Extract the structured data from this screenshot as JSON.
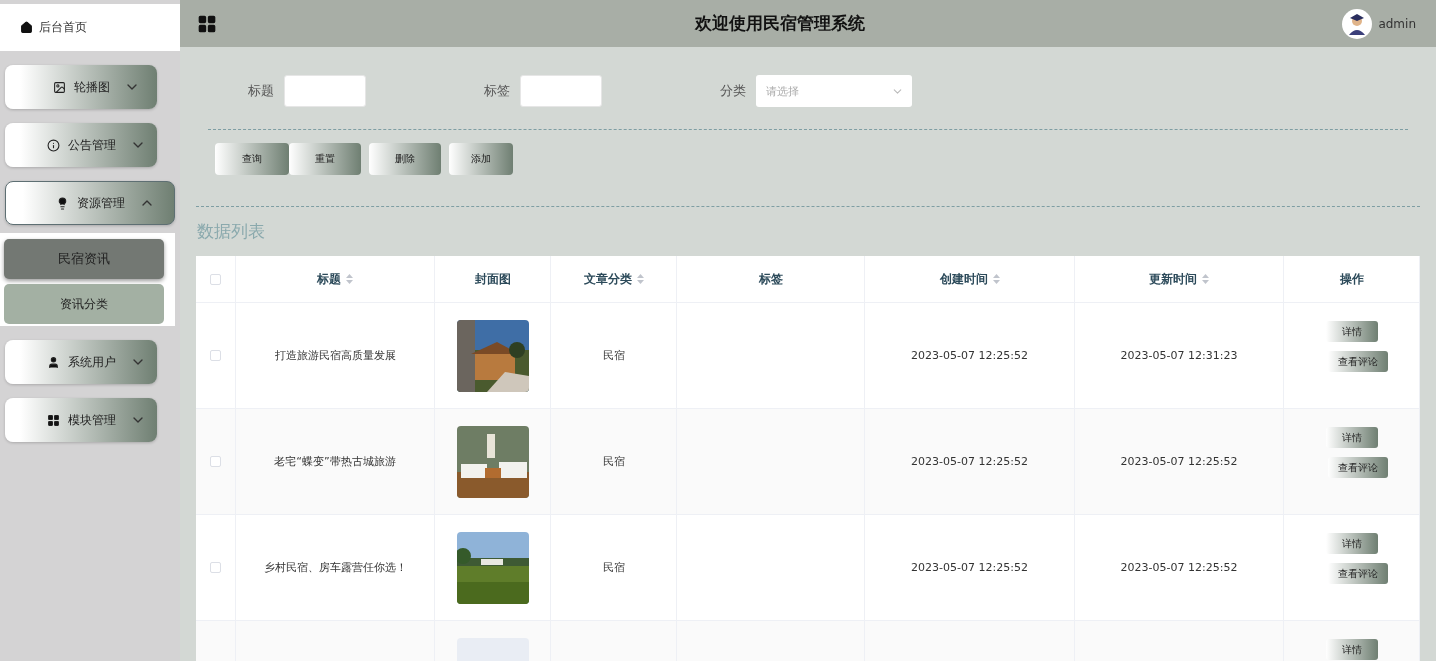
{
  "header": {
    "title": "欢迎使用民宿管理系统",
    "user": "admin"
  },
  "sidebar": {
    "home": "后台首页",
    "menus": [
      {
        "label": "轮播图",
        "expanded": false
      },
      {
        "label": "公告管理",
        "expanded": false
      },
      {
        "label": "资源管理",
        "expanded": true,
        "children": [
          {
            "label": "民宿资讯",
            "selected": true
          },
          {
            "label": "资讯分类",
            "selected": false
          }
        ]
      },
      {
        "label": "系统用户",
        "expanded": false
      },
      {
        "label": "模块管理",
        "expanded": false
      }
    ]
  },
  "search": {
    "fields": [
      {
        "label": "标题",
        "kind": "input"
      },
      {
        "label": "标签",
        "kind": "input"
      },
      {
        "label": "分类",
        "kind": "select",
        "placeholder": "请选择"
      }
    ],
    "buttons": [
      "查询",
      "重置",
      "删除",
      "添加"
    ]
  },
  "list_title": "数据列表",
  "table": {
    "all_checked": false,
    "columns": [
      {
        "label": "标题",
        "sortable": true
      },
      {
        "label": "封面图",
        "sortable": false
      },
      {
        "label": "文章分类",
        "sortable": true
      },
      {
        "label": "标签",
        "sortable": false
      },
      {
        "label": "创建时间",
        "sortable": true
      },
      {
        "label": "更新时间",
        "sortable": true
      },
      {
        "label": "操作",
        "sortable": false
      }
    ],
    "rows": [
      {
        "checked": false,
        "title": "打造旅游民宿高质量发展",
        "cover": {
          "kind": "picture"
        },
        "category": "民宿",
        "created": "2023-05-07 12:25:52",
        "updated": "2023-05-07 12:31:23",
        "actions": [
          "详情",
          "查看评论"
        ]
      },
      {
        "checked": false,
        "title": "老宅“蝶变”带热古城旅游",
        "cover": {
          "kind": "picture"
        },
        "category": "民宿",
        "created": "2023-05-07 12:25:52",
        "updated": "2023-05-07 12:25:52",
        "actions": [
          "详情",
          "查看评论"
        ]
      },
      {
        "checked": false,
        "title": "乡村民宿、房车露营任你选！",
        "cover": {
          "kind": "picture"
        },
        "category": "民宿",
        "created": "2023-05-07 12:25:52",
        "updated": "2023-05-07 12:25:52",
        "actions": [
          "详情",
          "查看评论"
        ]
      },
      {
        "cover": {
          "kind": "placeholder"
        },
        "actions": [
          "详情"
        ]
      }
    ]
  }
}
